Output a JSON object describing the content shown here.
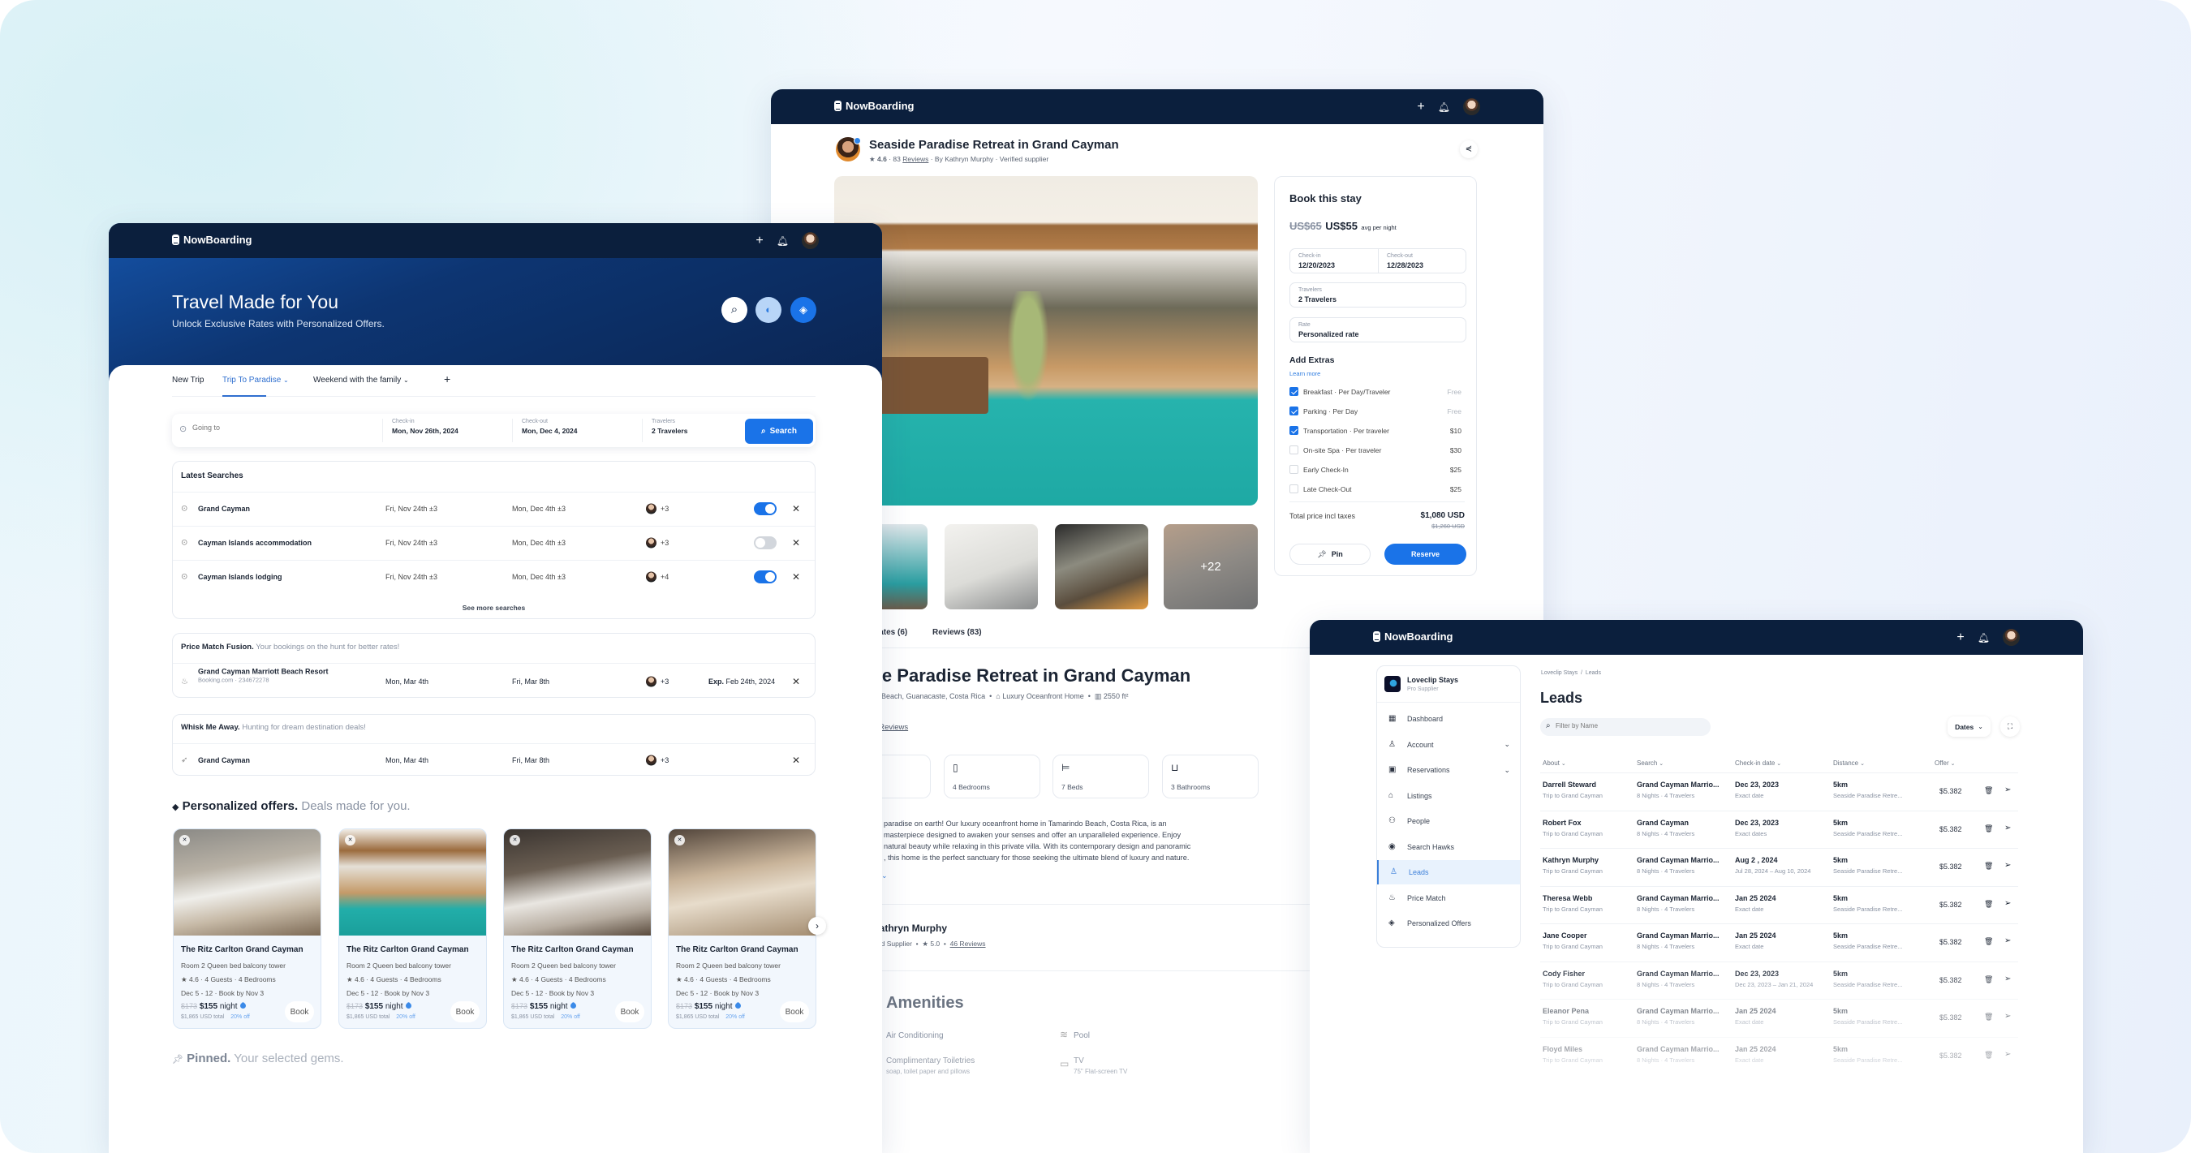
{
  "brand": "NowBoarding",
  "colors": {
    "navy": "#0b1f3d",
    "accent": "#1a73e8",
    "hero_start": "#1553a8",
    "hero_end": "#0b2552"
  },
  "home": {
    "hero": {
      "title": "Travel Made for You",
      "subtitle": "Unlock Exclusive Rates with Personalized Offers.",
      "icons": [
        "search-icon",
        "toggle-icon",
        "tag-icon"
      ]
    },
    "tabs": [
      {
        "label": "New Trip"
      },
      {
        "label": "Trip To Paradise",
        "active": true
      },
      {
        "label": "Weekend with the family"
      }
    ],
    "search": {
      "going_to_placeholder": "Going to",
      "checkin_label": "Check-in",
      "checkin": "Mon, Nov 26th, 2024",
      "checkout_label": "Check-out",
      "checkout": "Mon, Dec 4, 2024",
      "travelers_label": "Travelers",
      "travelers": "2 Travelers",
      "button": "Search"
    },
    "latest": {
      "title": "Latest Searches",
      "rows": [
        {
          "name": "Grand Cayman",
          "from": "Fri, Nov 24th ±3",
          "to": "Mon, Dec 4th ±3",
          "count": "+3",
          "enabled": true
        },
        {
          "name": "Cayman Islands accommodation",
          "from": "Fri, Nov 24th ±3",
          "to": "Mon, Dec 4th ±3",
          "count": "+3",
          "enabled": false
        },
        {
          "name": "Cayman Islands lodging",
          "from": "Fri, Nov 24th ±3",
          "to": "Mon, Dec 4th ±3",
          "count": "+4",
          "enabled": true
        }
      ],
      "more": "See more searches"
    },
    "price_match": {
      "title": "Price Match Fusion.",
      "subtitle": "Your bookings on the hunt for better rates!",
      "rows": [
        {
          "name": "Grand Cayman Marriott Beach Resort",
          "meta": "Booking.com · 234672278",
          "from": "Mon, Mar 4th",
          "to": "Fri, Mar 8th",
          "count": "+3",
          "exp_label": "Exp.",
          "exp": "Feb 24th, 2024"
        }
      ]
    },
    "whisk": {
      "title": "Whisk Me Away.",
      "subtitle": "Hunting for dream destination deals!",
      "rows": [
        {
          "name": "Grand Cayman",
          "from": "Mon, Mar 4th",
          "to": "Fri, Mar 8th",
          "count": "+3"
        }
      ]
    },
    "offers": {
      "title": "Personalized offers.",
      "subtitle": "Deals made for you.",
      "cards": [
        {
          "name": "The Ritz Carlton Grand Cayman",
          "room": "Room 2 Queen bed balcony tower",
          "rating": "4.6 · 4 Guests · 4 Bedrooms",
          "dates": "Dec 5 - 12 · Book by Nov 3",
          "old_price": "$173",
          "price": "$155",
          "unit": "night",
          "total": "$1,865 USD total",
          "discount": "20% off",
          "book": "Book"
        },
        {
          "name": "The Ritz Carlton Grand Cayman",
          "room": "Room 2 Queen bed balcony tower",
          "rating": "4.6 · 4 Guests · 4 Bedrooms",
          "dates": "Dec 5 - 12 · Book by Nov 3",
          "old_price": "$173",
          "price": "$155",
          "unit": "night",
          "total": "$1,865 USD total",
          "discount": "20% off",
          "book": "Book"
        },
        {
          "name": "The Ritz Carlton Grand Cayman",
          "room": "Room 2 Queen bed balcony tower",
          "rating": "4.6 · 4 Guests · 4 Bedrooms",
          "dates": "Dec 5 - 12 · Book by Nov 3",
          "old_price": "$173",
          "price": "$155",
          "unit": "night",
          "total": "$1,865 USD total",
          "discount": "20% off",
          "book": "Book"
        },
        {
          "name": "The Ritz Carlton Grand Cayman",
          "room": "Room 2 Queen bed balcony tower",
          "rating": "4.6 · 4 Guests · 4 Bedrooms",
          "dates": "Dec 5 - 12 · Book by Nov 3",
          "old_price": "$173",
          "price": "$155",
          "unit": "night",
          "total": "$1,865 USD total",
          "discount": "20% off",
          "book": "Book"
        }
      ]
    },
    "pinned": {
      "title": "Pinned.",
      "subtitle": "Your selected gems."
    }
  },
  "listing": {
    "title": "Seaside Paradise Retreat in Grand Cayman",
    "rating": "4.6",
    "reviews_count": "83",
    "reviews_word": "Reviews",
    "by": "By Kathryn Murphy · Verified supplier",
    "more_photos": "+22",
    "tabs": [
      "Rates (6)",
      "Reviews (83)"
    ],
    "location": "Beach, Guanacaste, Costa Rica",
    "type": "Luxury Oceanfront Home",
    "area": "2550 ft²",
    "reviews_link": "83 Reviews",
    "features": [
      "4 Bedrooms",
      "7 Beds",
      "3 Bathrooms"
    ],
    "description": [
      "paradise on earth! Our luxury oceanfront home in Tamarindo Beach, Costa Rica, is an",
      "masterpiece designed to awaken your senses and offer an unparalleled experience. Enjoy",
      "natural beauty while relaxing in this private villa. With its contemporary design and panoramic",
      ", this home is the perfect sanctuary for those seeking the ultimate blend of luxury and nature."
    ],
    "host": {
      "name": "Kathryn Murphy",
      "role": "Verified Supplier",
      "rating": "5.0",
      "reviews": "46 Reviews"
    },
    "amenities": {
      "title": "Amenities",
      "items": [
        {
          "name": "Air Conditioning",
          "detail": ""
        },
        {
          "name": "Pool",
          "detail": ""
        },
        {
          "name": "Complimentary Toiletries",
          "detail": "soap, toilet paper and pillows"
        },
        {
          "name": "TV",
          "detail": "75\" Flat-screen TV"
        }
      ]
    },
    "book": {
      "title": "Book this stay",
      "old_price": "US$65",
      "price": "US$55",
      "price_unit": "avg per night",
      "checkin_label": "Check-in",
      "checkin": "12/20/2023",
      "checkout_label": "Check-out",
      "checkout": "12/28/2023",
      "travelers_label": "Travelers",
      "travelers": "2 Travelers",
      "rate_label": "Rate",
      "rate": "Personalized rate",
      "extras_title": "Add Extras",
      "learn_more": "Learn more",
      "extras": [
        {
          "name": "Breakfast · Per Day/Traveler",
          "price": "Free",
          "checked": true
        },
        {
          "name": "Parking · Per Day",
          "price": "Free",
          "checked": true
        },
        {
          "name": "Transportation · Per traveler",
          "price": "$10",
          "checked": true
        },
        {
          "name": "On-site Spa · Per traveler",
          "price": "$30",
          "checked": false
        },
        {
          "name": "Early Check-In",
          "price": "$25",
          "checked": false
        },
        {
          "name": "Late Check-Out",
          "price": "$25",
          "checked": false
        }
      ],
      "total_label": "Total price incl taxes",
      "total": "$1,080 USD",
      "total_old": "$1,260 USD",
      "pin": "Pin",
      "reserve": "Reserve"
    }
  },
  "leads": {
    "org": {
      "name": "Loveclip Stays",
      "tier": "Pro Supplier"
    },
    "nav": [
      {
        "label": "Dashboard",
        "icon": "dashboard-icon",
        "glyph": "▦"
      },
      {
        "label": "Account",
        "icon": "user-icon",
        "glyph": "♙",
        "expandable": true
      },
      {
        "label": "Reservations",
        "icon": "calendar-icon",
        "glyph": "▣",
        "expandable": true
      },
      {
        "label": "Listings",
        "icon": "building-icon",
        "glyph": "⌂"
      },
      {
        "label": "People",
        "icon": "people-icon",
        "glyph": "⚇"
      },
      {
        "label": "Search Hawks",
        "icon": "eye-icon",
        "glyph": "◉"
      },
      {
        "label": "Leads",
        "icon": "user-search-icon",
        "glyph": "♙",
        "active": true
      },
      {
        "label": "Price Match",
        "icon": "flame-icon",
        "glyph": "♨"
      },
      {
        "label": "Personalized Offers",
        "icon": "tag-icon",
        "glyph": "◈"
      }
    ],
    "breadcrumb": [
      "Loveclip Stays",
      "Leads"
    ],
    "title": "Leads",
    "filter_placeholder": "Filter by Name",
    "dates_button": "Dates",
    "columns": [
      "About",
      "Search",
      "Check-in date",
      "Distance",
      "Offer"
    ],
    "rows": [
      {
        "name": "Darrell Steward",
        "trip": "Trip to Grand Cayman",
        "search": "Grand Cayman Marrio...",
        "search_meta": "8 Nights · 4 Travelers",
        "date": "Dec 23, 2023",
        "date_meta": "Exact date",
        "distance": "5km",
        "distance_meta": "Seaside Paradise Retre...",
        "offer": "$5.382"
      },
      {
        "name": "Robert Fox",
        "trip": "Trip to Grand Cayman",
        "search": "Grand Cayman",
        "search_meta": "8 Nights · 4 Travelers",
        "date": "Dec 23, 2023",
        "date_meta": "Exact dates",
        "distance": "5km",
        "distance_meta": "Seaside Paradise Retre...",
        "offer": "$5.382"
      },
      {
        "name": "Kathryn Murphy",
        "trip": "Trip to Grand Cayman",
        "search": "Grand Cayman Marrio...",
        "search_meta": "8 Nights · 4 Travelers",
        "date": "Aug 2 , 2024",
        "date_meta": "Jul 28, 2024 – Aug 10, 2024",
        "distance": "5km",
        "distance_meta": "Seaside Paradise Retre...",
        "offer": "$5.382"
      },
      {
        "name": "Theresa Webb",
        "trip": "Trip to Grand Cayman",
        "search": "Grand Cayman Marrio...",
        "search_meta": "8 Nights · 4 Travelers",
        "date": "Jan 25 2024",
        "date_meta": "Exact date",
        "distance": "5km",
        "distance_meta": "Seaside Paradise Retre...",
        "offer": "$5.382"
      },
      {
        "name": "Jane Cooper",
        "trip": "Trip to Grand Cayman",
        "search": "Grand Cayman Marrio...",
        "search_meta": "8 Nights · 4 Travelers",
        "date": "Jan 25 2024",
        "date_meta": "Exact date",
        "distance": "5km",
        "distance_meta": "Seaside Paradise Retre...",
        "offer": "$5.382"
      },
      {
        "name": "Cody Fisher",
        "trip": "Trip to Grand Cayman",
        "search": "Grand Cayman Marrio...",
        "search_meta": "8 Nights · 4 Travelers",
        "date": "Dec 23, 2023",
        "date_meta": "Dec 23, 2023 – Jan 21, 2024",
        "distance": "5km",
        "distance_meta": "Seaside Paradise Retre...",
        "offer": "$5.382"
      },
      {
        "name": "Eleanor Pena",
        "trip": "Trip to Grand Cayman",
        "search": "Grand Cayman Marrio...",
        "search_meta": "8 Nights · 4 Travelers",
        "date": "Jan 25 2024",
        "date_meta": "Exact date",
        "distance": "5km",
        "distance_meta": "Seaside Paradise Retre...",
        "offer": "$5.382"
      },
      {
        "name": "Floyd Miles",
        "trip": "Trip to Grand Cayman",
        "search": "Grand Cayman Marrio...",
        "search_meta": "8 Nights · 4 Travelers",
        "date": "Jan 25 2024",
        "date_meta": "Exact date",
        "distance": "5km",
        "distance_meta": "Seaside Paradise Retre...",
        "offer": "$5.382"
      }
    ]
  }
}
